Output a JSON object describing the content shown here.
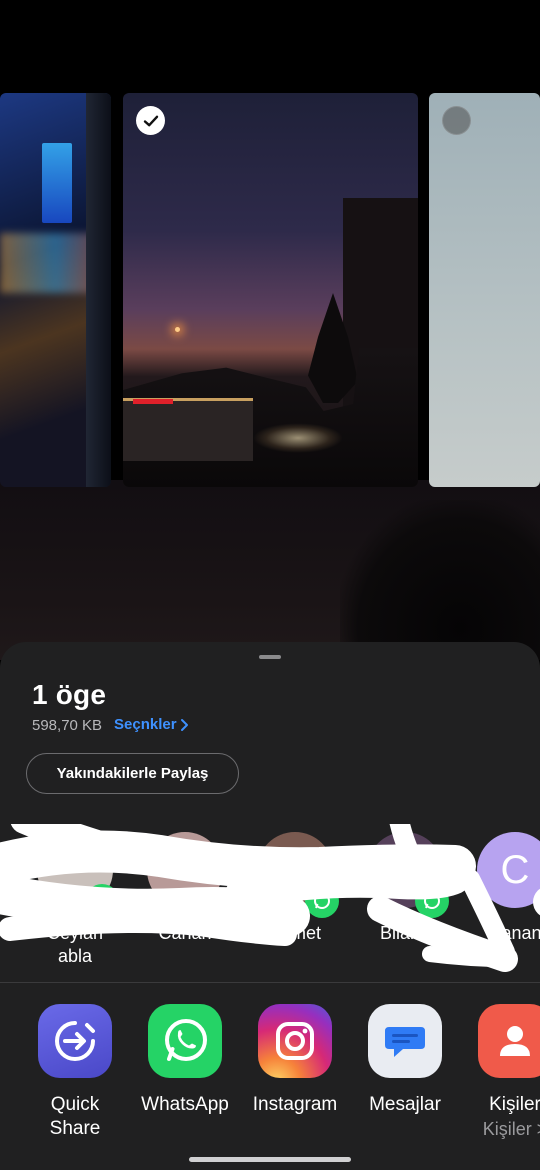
{
  "selection": {
    "count_label": "1 öge",
    "size_label": "598,70 KB",
    "options_label": "Seçnkler"
  },
  "nearby_share_label": "Yakındakilerle Paylaş",
  "direct_share": [
    {
      "name_line1": "Ceylan",
      "name_line2": "abla",
      "avatar_color": "#c9c0bb",
      "badge": "whatsapp"
    },
    {
      "name_line1": "Canan",
      "name_line2": "",
      "avatar_color": "#b89a98",
      "badge": ""
    },
    {
      "name_line1": "Ahmet",
      "name_line2": "",
      "avatar_color": "#7a5a50",
      "badge": "whatsapp"
    },
    {
      "name_line1": "Bilal A",
      "name_line2": "",
      "avatar_color": "#55405a",
      "badge": "whatsapp"
    },
    {
      "name_line1": "Canan",
      "name_line2": "",
      "avatar_color": "#b7a3f0",
      "avatar_letter": "C",
      "badge": "messages"
    }
  ],
  "apps": [
    {
      "name_line1": "Quick",
      "name_line2": "Share",
      "icon": "quick-share-icon",
      "color": "#5b59d6"
    },
    {
      "name_line1": "WhatsApp",
      "name_line2": "",
      "icon": "whatsapp-icon",
      "color": "#25d366"
    },
    {
      "name_line1": "Instagram",
      "name_line2": "",
      "icon": "instagram-icon",
      "color": "#d6297d"
    },
    {
      "name_line1": "Mesajlar",
      "name_line2": "",
      "icon": "messages-icon",
      "color": "#e9ecf2"
    },
    {
      "name_line1": "Kişiler",
      "name_line2": "Kişiler >",
      "icon": "contacts-icon",
      "color": "#f05a4a"
    }
  ],
  "colors": {
    "sheet_bg": "#202021",
    "accent_blue": "#3e91ff"
  }
}
